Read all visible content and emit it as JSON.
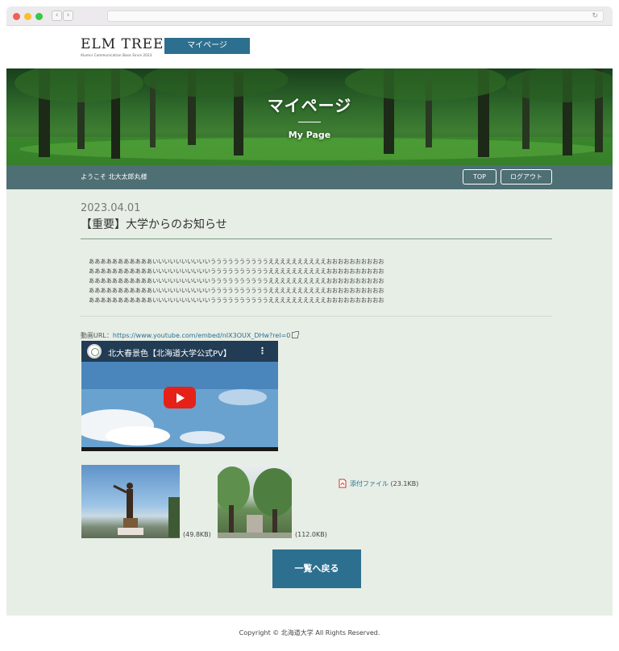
{
  "header": {
    "logo_main": "ELM TREE",
    "logo_sub": "Alumni Communication Base Since 2023",
    "mypage_button": "マイページ"
  },
  "hero": {
    "title": "マイページ",
    "subtitle": "My Page"
  },
  "welcome_bar": {
    "text": "ようこそ 北大太郎丸様",
    "top_button": "TOP",
    "logout_button": "ログアウト"
  },
  "article": {
    "date": "2023.04.01",
    "title": "【重要】大学からのお知らせ",
    "body_lines": [
      "あああああああああああいいいいいいいいいいううううううううううええええええええええおおおおおおおおおお",
      "あああああああああああいいいいいいいいいいううううううううううええええええええええおおおおおおおおおお",
      "あああああああああああいいいいいいいいいいううううううううううええええええええええおおおおおおおおおお",
      "あああああああああああいいいいいいいいいいううううううううううええええええええええおおおおおおおおおお",
      "あああああああああああいいいいいいいいいいううううううううううええええええええええおおおおおおおおおお"
    ],
    "video_label": "動画URL：",
    "video_url": "https://www.youtube.com/embed/nIX3OUX_DHw?rel=0",
    "video_title": "北大春景色【北海道大学公式PV】",
    "images": [
      {
        "size": "(49.8KB)"
      },
      {
        "size": "(112.0KB)"
      }
    ],
    "attachment_label": "添付ファイル",
    "attachment_size": "(23.1KB)",
    "back_button": "一覧へ戻る"
  },
  "footer": {
    "copyright": "Copyright © 北海道大学 All Rights Reserved."
  },
  "colors": {
    "accent": "#2d6f8e",
    "welcome_bar": "#4e6f73",
    "main_bg": "#e7eee6"
  }
}
